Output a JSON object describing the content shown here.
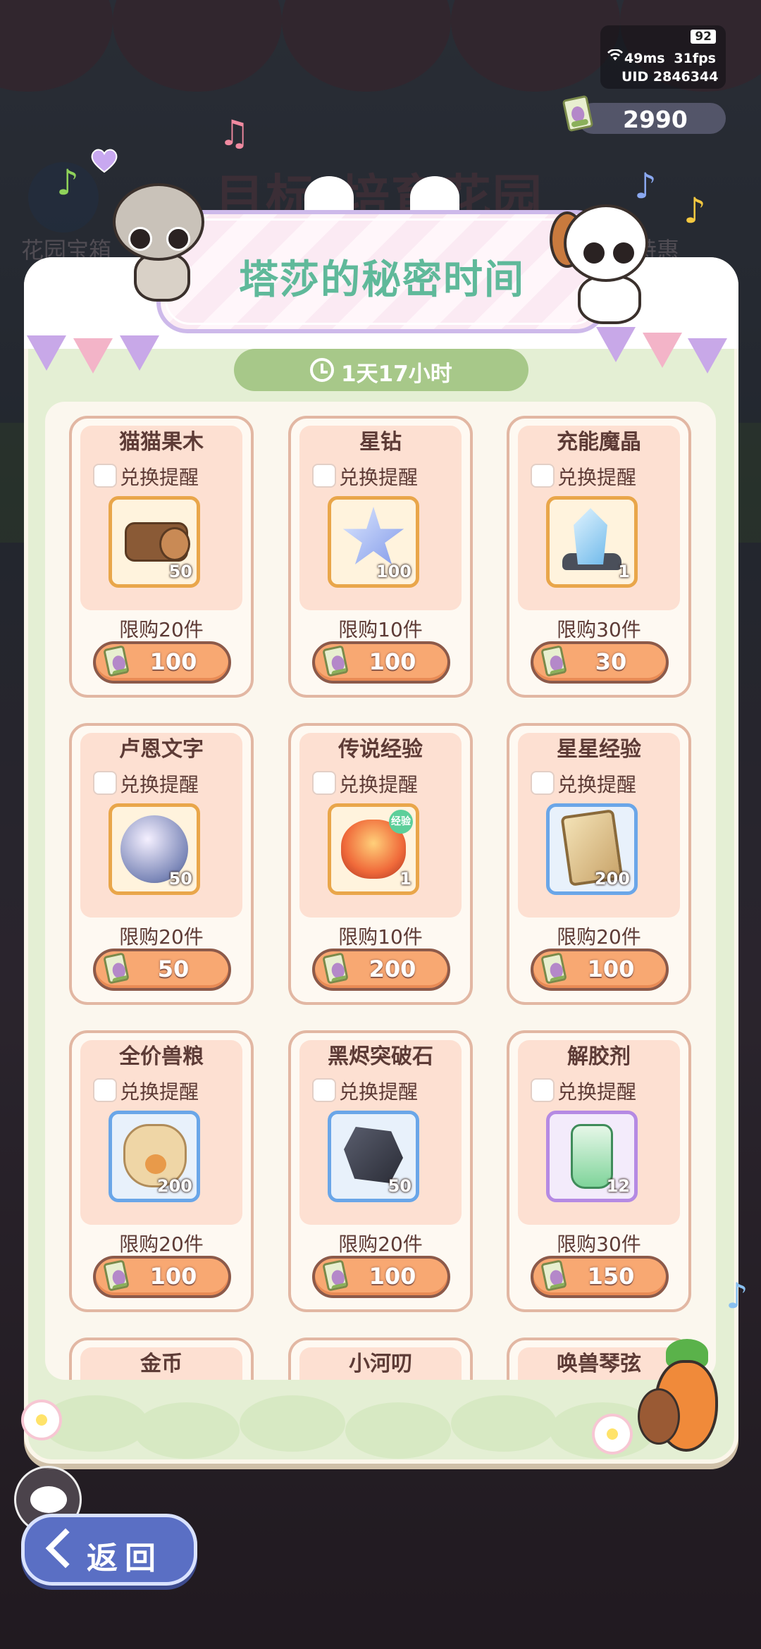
{
  "background": {
    "title": "目标!培育花园",
    "left_label": "花园宝箱",
    "right_label": "特惠"
  },
  "status": {
    "battery": "92",
    "ping": "49ms",
    "fps": "31fps",
    "uid": "UID 2846344"
  },
  "currency": {
    "amount": "2990",
    "icon": "ticket-icon"
  },
  "event": {
    "title": "塔莎的秘密时间",
    "timer": "1天17小时"
  },
  "shop": {
    "remind_label": "兑换提醒",
    "items": [
      {
        "name": "猫猫果木",
        "qty": "50",
        "limit": "限购20件",
        "price": "100",
        "art": "log"
      },
      {
        "name": "星钻",
        "qty": "100",
        "limit": "限购10件",
        "price": "100",
        "art": "star"
      },
      {
        "name": "充能魔晶",
        "qty": "1",
        "limit": "限购30件",
        "price": "30",
        "art": "crystal"
      },
      {
        "name": "卢恩文字",
        "qty": "50",
        "limit": "限购20件",
        "price": "50",
        "art": "rune"
      },
      {
        "name": "传说经验",
        "qty": "1",
        "limit": "限购10件",
        "price": "200",
        "art": "orb",
        "tag": "经验"
      },
      {
        "name": "星星经验",
        "qty": "200",
        "limit": "限购20件",
        "price": "100",
        "art": "card"
      },
      {
        "name": "全价兽粮",
        "qty": "200",
        "limit": "限购20件",
        "price": "100",
        "art": "sack"
      },
      {
        "name": "黑烬突破石",
        "qty": "50",
        "limit": "限购20件",
        "price": "100",
        "art": "rock"
      },
      {
        "name": "解胶剂",
        "qty": "12",
        "limit": "限购30件",
        "price": "150",
        "art": "bottle"
      },
      {
        "name": "金币"
      },
      {
        "name": "小河叨"
      },
      {
        "name": "唤兽琴弦"
      }
    ]
  },
  "nav": {
    "back_label": "返回"
  },
  "colors": {
    "accent": "#5fb99a",
    "button": "#f8a872",
    "panel": "#e4efd4"
  }
}
